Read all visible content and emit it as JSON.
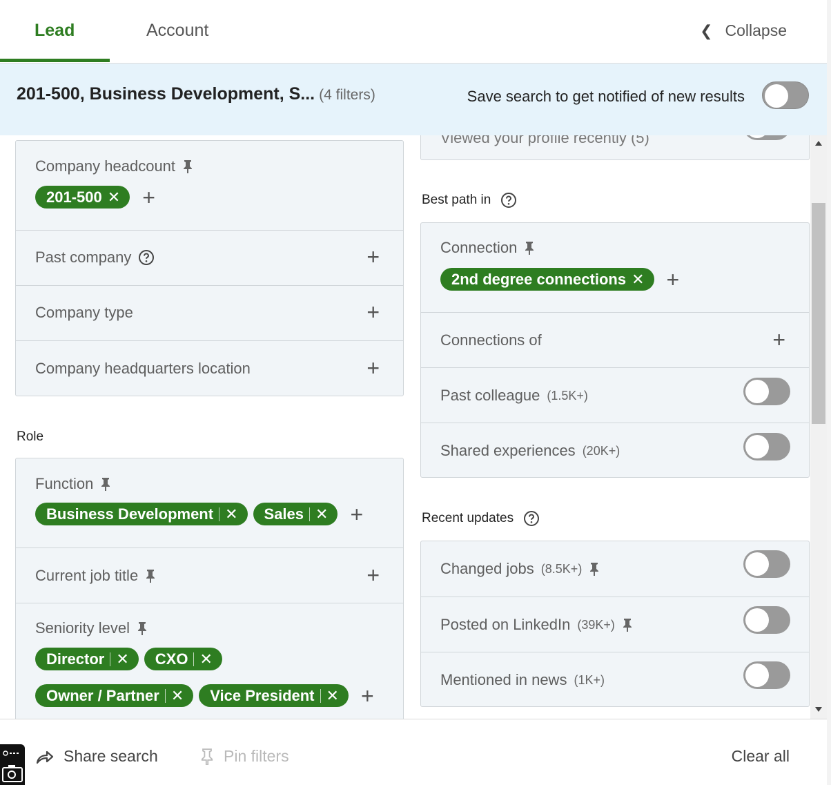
{
  "tabs": [
    {
      "label": "Lead",
      "active": true
    },
    {
      "label": "Account",
      "active": false
    }
  ],
  "collapse_label": "Collapse",
  "banner": {
    "summary": "201-500, Business Development, S...",
    "count": "(4 filters)",
    "save_text": "Save search to get notified of new results"
  },
  "left": {
    "company_headcount": {
      "label": "Company headcount",
      "chips": [
        "201-500"
      ]
    },
    "past_company": "Past company",
    "company_type": "Company type",
    "company_hq": "Company headquarters location",
    "role_title": "Role",
    "function": {
      "label": "Function",
      "chips": [
        "Business Development",
        "Sales"
      ]
    },
    "current_job_title": "Current job title",
    "seniority": {
      "label": "Seniority level",
      "chips": [
        "Director",
        "CXO",
        "Owner / Partner",
        "Vice President"
      ]
    }
  },
  "right": {
    "partial_row": "Viewed your profile recently (5)",
    "best_path_title": "Best path in",
    "connection": {
      "label": "Connection",
      "chips": [
        "2nd degree connections"
      ]
    },
    "connections_of": "Connections of",
    "past_colleague": {
      "label": "Past colleague",
      "sub": "(1.5K+)"
    },
    "shared_experiences": {
      "label": "Shared experiences",
      "sub": "(20K+)"
    },
    "recent_updates_title": "Recent updates",
    "changed_jobs": {
      "label": "Changed jobs",
      "sub": "(8.5K+)"
    },
    "posted": {
      "label": "Posted on LinkedIn",
      "sub": "(39K+)"
    },
    "mentioned": {
      "label": "Mentioned in news",
      "sub": "(1K+)"
    }
  },
  "footer": {
    "share": "Share search",
    "pin": "Pin filters",
    "clear": "Clear all"
  },
  "colors": {
    "accent": "#2e7d21",
    "banner": "#e6f3fb",
    "card": "#f1f5f8"
  }
}
